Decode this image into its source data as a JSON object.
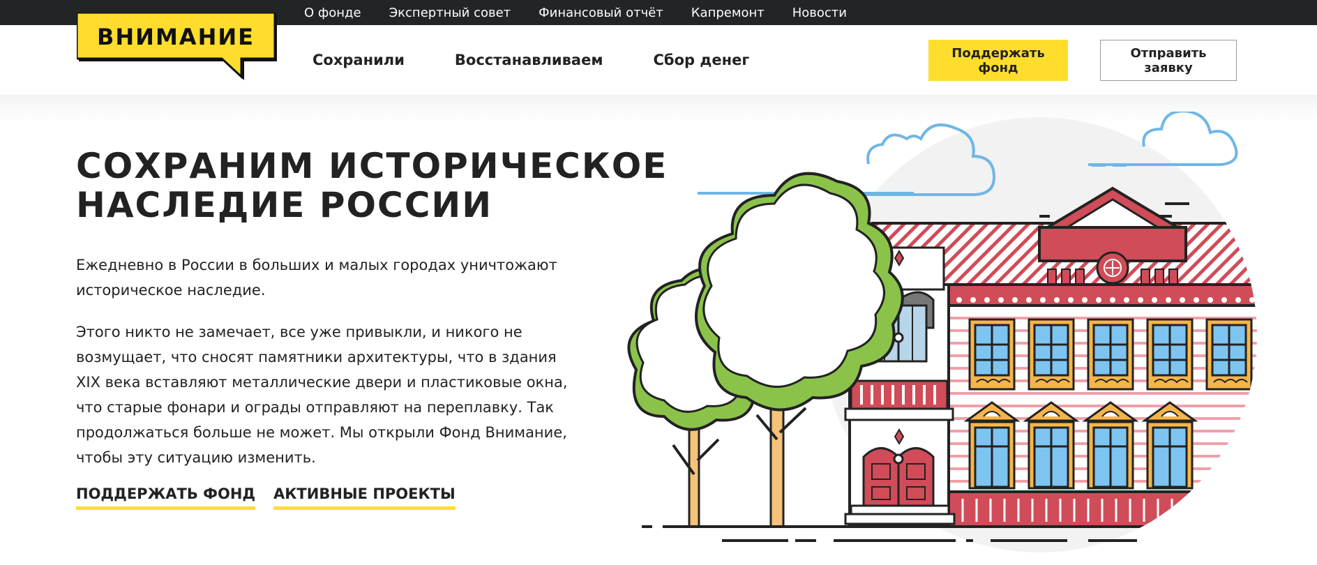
{
  "brand": {
    "logo_text": "ВНИМАНИЕ",
    "logo_color": "#FFDD2D"
  },
  "topnav": {
    "items": [
      {
        "label": "О фонде"
      },
      {
        "label": "Экспертный совет"
      },
      {
        "label": "Финансовый отчёт"
      },
      {
        "label": "Капремонт"
      },
      {
        "label": "Новости"
      }
    ]
  },
  "mainnav": {
    "items": [
      {
        "label": "Сохранили"
      },
      {
        "label": "Восстанавливаем"
      },
      {
        "label": "Сбор денег"
      }
    ]
  },
  "header_buttons": {
    "support_label": "Поддержать фонд",
    "apply_label": "Отправить заявку"
  },
  "hero": {
    "title_line1": "СОХРАНИМ ИСТОРИЧЕСКОЕ",
    "title_line2": "НАСЛЕДИЕ РОССИИ",
    "paragraph1": "Ежедневно в России в больших и малых городах уничтожают историческое наследие.",
    "paragraph2": "Этого никто не замечает, все уже привыкли, и никого не возмущает, что сносят памятники архитектуры, что в здания XIX века вставляют металлические двери и пластиковые окна, что старые фонари и ограды отправляют на переплавку. Так продолжаться больше не может. Мы открыли Фонд Внимание, чтобы эту ситуацию изменить.",
    "cta_support": "ПОДДЕРЖАТЬ ФОНД",
    "cta_projects": "АКТИВНЫЕ ПРОЕКТЫ"
  },
  "colors": {
    "accent": "#FFDD2D",
    "topbar": "#222425",
    "text": "#222222"
  },
  "icons": {
    "logo": "speech-bubble-logo",
    "illustration": "historic-building-with-trees"
  }
}
